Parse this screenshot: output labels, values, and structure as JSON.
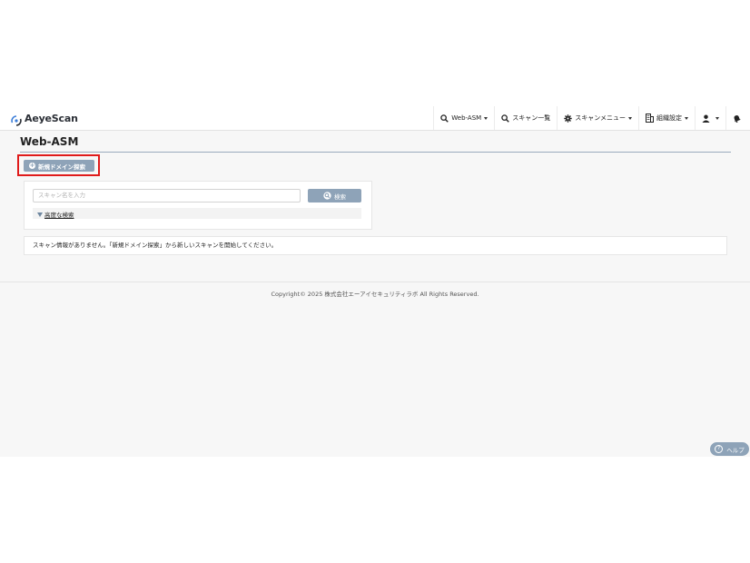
{
  "brand": {
    "name": "AeyeScan"
  },
  "nav": {
    "items": [
      {
        "label": "Web-ASM",
        "icon": "search-icon",
        "dropdown": true
      },
      {
        "label": "スキャン一覧",
        "icon": "search-icon",
        "dropdown": false
      },
      {
        "label": "スキャンメニュー",
        "icon": "gear-icon",
        "dropdown": true
      },
      {
        "label": "組織設定",
        "icon": "building-icon",
        "dropdown": true
      },
      {
        "label": "",
        "icon": "user-icon",
        "dropdown": true
      },
      {
        "label": "",
        "icon": "bell-icon",
        "dropdown": false
      }
    ]
  },
  "page": {
    "title": "Web-ASM",
    "new_button_label": "新規ドメイン探索"
  },
  "search": {
    "placeholder": "スキャン名を入力",
    "button_label": "検索",
    "advanced_label": "高度な検索"
  },
  "info": {
    "message": "スキャン情報がありません。「新規ドメイン探索」から新しいスキャンを開始してください。"
  },
  "footer": {
    "copyright": "Copyright© 2025 株式会社エーアイセキュリティラボ All Rights Reserved."
  },
  "help": {
    "label": "ヘルプ"
  },
  "colors": {
    "accent": "#8ea3b8",
    "highlight": "#e01b1b",
    "background": "#f7f7f7"
  }
}
